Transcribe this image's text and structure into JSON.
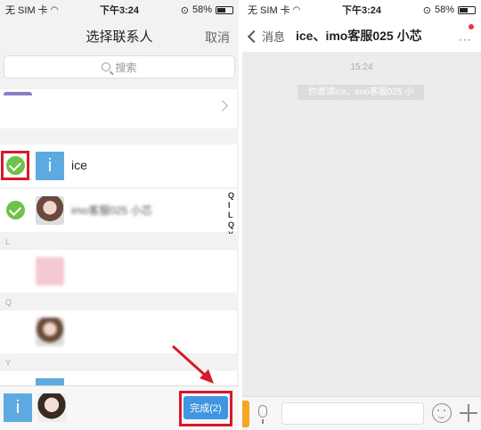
{
  "left_status": {
    "carrier": "无 SIM 卡",
    "time": "下午3:24",
    "battery": "58%"
  },
  "right_status": {
    "carrier": "无 SIM 卡",
    "time": "下午3:24",
    "battery": "58%"
  },
  "picker": {
    "title": "选择联系人",
    "cancel_label": "取消",
    "search_placeholder": "搜索",
    "contacts": [
      {
        "avatar_letter": "i",
        "name": "ice"
      },
      {
        "name": "imo客服025 小芯"
      }
    ],
    "sections": [
      "L",
      "Q",
      "Y"
    ],
    "alpha_index": [
      "Q",
      "I",
      "L",
      "Q",
      "Y"
    ],
    "selected_avatar_letter": "i",
    "done_label": "完成(2)"
  },
  "chat": {
    "back_label": "消息",
    "title": "ice、imo客服025 小芯",
    "more_label": "···",
    "time": "15:24",
    "system_message": "你邀请ice、imo客服025 小"
  },
  "colors": {
    "accent": "#4096e0",
    "check": "#6cc24a",
    "highlight": "#d8192a",
    "avatar": "#5eaae0"
  }
}
